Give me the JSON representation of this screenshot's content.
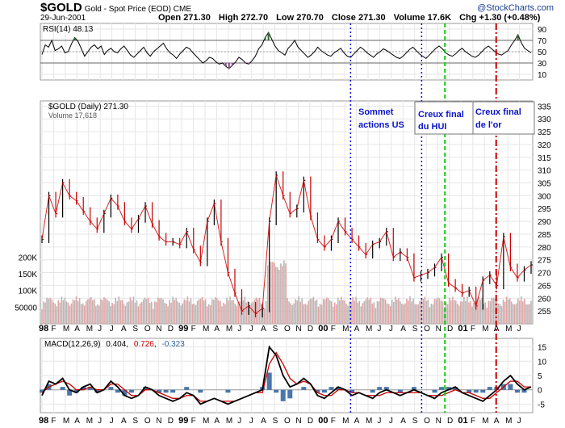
{
  "header": {
    "symbol": "$GOLD",
    "name": "Gold - Spot Price (EOD) CME",
    "date": "29-Jun-2001",
    "open_label": "Open",
    "open": "271.30",
    "high_label": "High",
    "high": "272.70",
    "low_label": "Low",
    "low": "270.70",
    "close_label": "Close",
    "close": "271.30",
    "volume_label": "Volume",
    "volume": "17.6K",
    "chg_label": "Chg",
    "chg": "+1.30 (+0.48%)",
    "watermark": "@StockCharts.com"
  },
  "colors": {
    "price_up": "#000000",
    "price_down": "#cc0000",
    "volume_up": "#b7b7b7",
    "volume_down": "#e3a4a4",
    "rsi_line": "#000000",
    "rsi_overbought": "#2e6b2e",
    "rsi_oversold": "#8a4a8a",
    "macd_line": "#000000",
    "signal_line": "#cc0000",
    "histogram": "#2a5f9e",
    "marker_us": "#1010cc",
    "marker_hui": "#10cc10",
    "marker_gold": "#cc0000",
    "annotation_text": "#0a14c8"
  },
  "chart_data": [
    {
      "type": "line",
      "panel": "rsi",
      "label": "RSI(14) 48.13",
      "ylim": [
        0,
        100
      ],
      "yticks": [
        10,
        30,
        50,
        70,
        90
      ],
      "reference_lines": [
        30,
        70
      ],
      "series": [
        {
          "name": "RSI(14)",
          "values": [
            45,
            62,
            58,
            70,
            52,
            55,
            60,
            48,
            50,
            64,
            75,
            68,
            55,
            42,
            50,
            58,
            62,
            55,
            60,
            45,
            52,
            56,
            50,
            48,
            55,
            60,
            52,
            44,
            40,
            46,
            52,
            58,
            48,
            42,
            50,
            55,
            60,
            65,
            55,
            48,
            44,
            38,
            46,
            52,
            58,
            55,
            48,
            42,
            36,
            30,
            34,
            40,
            38,
            32,
            28,
            30,
            24,
            20,
            26,
            32,
            40,
            36,
            30,
            28,
            34,
            42,
            55,
            62,
            75,
            84,
            72,
            60,
            52,
            48,
            44,
            56,
            62,
            70,
            58,
            52,
            46,
            40,
            44,
            50,
            58,
            52,
            48,
            44,
            42,
            48,
            52,
            56,
            48,
            42,
            40,
            46,
            52,
            58,
            54,
            48,
            44,
            40,
            46,
            50,
            55,
            52,
            48,
            44,
            40,
            38,
            42,
            48,
            54,
            58,
            52,
            46,
            42,
            38,
            44,
            50,
            56,
            60,
            55,
            48,
            44,
            42,
            46,
            52,
            56,
            50,
            46,
            42,
            40,
            44,
            50,
            56,
            60,
            55,
            50,
            46,
            44,
            48,
            52,
            62,
            70,
            80,
            66,
            56,
            52,
            48
          ]
        }
      ]
    },
    {
      "type": "line",
      "panel": "price",
      "label": "$GOLD (Daily) 271.30",
      "volume_label": "Volume 17,618",
      "x": [
        "1998-01",
        "1998-02",
        "1998-03",
        "1998-04",
        "1998-05",
        "1998-06",
        "1998-07",
        "1998-08",
        "1998-09",
        "1998-10",
        "1998-11",
        "1998-12",
        "1999-01",
        "1999-02",
        "1999-03",
        "1999-04",
        "1999-05",
        "1999-06",
        "1999-07",
        "1999-08",
        "1999-09",
        "1999-10",
        "1999-11",
        "1999-12",
        "2000-01",
        "2000-02",
        "2000-03",
        "2000-04",
        "2000-05",
        "2000-06",
        "2000-07",
        "2000-08",
        "2000-09",
        "2000-10",
        "2000-11",
        "2000-12",
        "2001-01",
        "2001-02",
        "2001-03",
        "2001-04",
        "2001-05",
        "2001-06"
      ],
      "ylim": [
        250,
        337
      ],
      "yticks": [
        255,
        260,
        265,
        270,
        275,
        280,
        285,
        290,
        295,
        300,
        305,
        310,
        315,
        320,
        325,
        330,
        335
      ],
      "series": [
        {
          "name": "$GOLD (Daily)",
          "values": [
            283,
            300,
            293,
            305,
            300,
            298,
            294,
            290,
            287,
            293,
            299,
            296,
            290,
            287,
            291,
            296,
            289,
            284,
            282,
            282,
            281,
            286,
            279,
            274,
            290,
            297,
            282,
            270,
            262,
            255,
            257,
            254,
            256,
            290,
            308,
            300,
            293,
            295,
            306,
            292,
            283,
            280,
            283,
            290,
            286,
            283,
            280,
            277,
            281,
            282,
            286,
            276,
            278,
            276,
            268,
            269,
            270,
            272,
            276,
            266,
            264,
            262,
            263,
            257,
            267,
            269,
            265,
            284,
            272,
            268,
            271,
            273
          ]
        }
      ]
    },
    {
      "type": "bar",
      "panel": "volume",
      "yticks": [
        50000,
        100000,
        150000,
        200000
      ],
      "ytick_labels": [
        "50000",
        "100K",
        "150K",
        "200K"
      ]
    },
    {
      "type": "line",
      "panel": "macd",
      "label": "MACD(12,26,9)",
      "values_label": {
        "macd": "0.404",
        "signal": "0.726",
        "hist": "-0.323"
      },
      "ylim": [
        -8,
        18
      ],
      "yticks": [
        -5,
        0,
        5,
        10,
        15
      ],
      "series": [
        {
          "name": "MACD(12,26,9)",
          "values": [
            -2,
            3,
            2,
            4,
            0,
            -1,
            1,
            2,
            -1,
            0,
            3,
            1,
            -2,
            -3,
            -2,
            1,
            0,
            -2,
            -3,
            -4,
            -3,
            -1,
            -2,
            -5,
            -4,
            -3,
            -4,
            -5,
            -4,
            -3,
            -2,
            -1,
            0,
            15,
            12,
            5,
            1,
            2,
            4,
            2,
            -2,
            -3,
            -1,
            1,
            0,
            -2,
            -1,
            -2,
            -3,
            -1,
            0,
            -1,
            -2,
            -1,
            0,
            -1,
            -2,
            -3,
            -1,
            0,
            1,
            -1,
            -2,
            -3,
            -4,
            -2,
            0,
            3,
            5,
            2,
            0,
            1
          ]
        },
        {
          "name": "Signal",
          "values": [
            -1,
            1,
            2,
            3,
            2,
            0,
            0,
            1,
            0,
            0,
            2,
            2,
            0,
            -2,
            -2,
            0,
            0,
            -1,
            -2,
            -3,
            -3,
            -2,
            -2,
            -4,
            -4,
            -3,
            -4,
            -4,
            -4,
            -3,
            -2,
            -1,
            -1,
            9,
            13,
            9,
            4,
            2,
            3,
            2,
            -1,
            -2,
            -2,
            0,
            0,
            -1,
            -1,
            -2,
            -2,
            -2,
            -1,
            -1,
            -1,
            -1,
            -1,
            -1,
            -2,
            -2,
            -2,
            -1,
            0,
            -1,
            -1,
            -2,
            -3,
            -3,
            -1,
            1,
            3,
            3,
            1,
            1
          ]
        }
      ]
    }
  ],
  "x_axis": {
    "labels": [
      "98",
      "F",
      "M",
      "A",
      "M",
      "J",
      "J",
      "A",
      "S",
      "O",
      "N",
      "D",
      "99",
      "F",
      "M",
      "A",
      "M",
      "J",
      "J",
      "A",
      "S",
      "O",
      "N",
      "D",
      "00",
      "F",
      "M",
      "A",
      "M",
      "J",
      "J",
      "A",
      "S",
      "O",
      "N",
      "D",
      "01",
      "F",
      "M",
      "A",
      "M",
      "J"
    ],
    "year_labels": [
      "98",
      "99",
      "00",
      "01"
    ]
  },
  "annotations": {
    "us_top": "Sommet actions US",
    "us_top_line1": "Sommet",
    "us_top_line2": "actions US",
    "hui_bottom_line1": "Creux final",
    "hui_bottom_line2": "du HUI",
    "gold_bottom_line1": "Creux final",
    "gold_bottom_line2": "de l'or"
  },
  "markers": [
    {
      "name": "us-top-marker",
      "month_index": 26.5,
      "style": "dotted",
      "color_key": "marker_us"
    },
    {
      "name": "hui-dotted-marker",
      "month_index": 32.6,
      "style": "dotted",
      "color_key": "marker_us"
    },
    {
      "name": "hui-bottom-marker",
      "month_index": 34.6,
      "style": "dashed",
      "color_key": "marker_hui"
    },
    {
      "name": "gold-bottom-marker",
      "month_index": 39.0,
      "style": "dashdot",
      "color_key": "marker_gold"
    }
  ]
}
